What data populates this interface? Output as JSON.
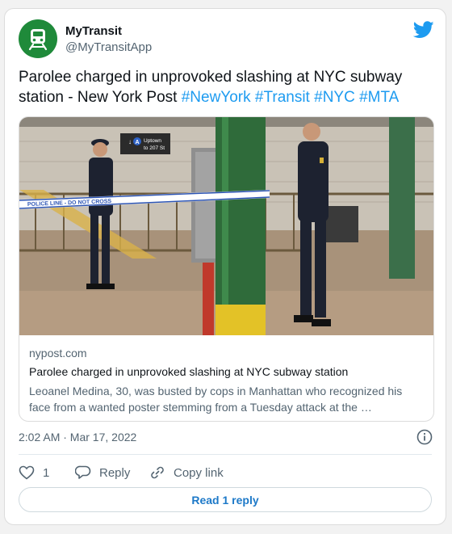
{
  "account": {
    "name": "MyTransit",
    "handle": "@MyTransitApp"
  },
  "tweet": {
    "text": "Parolee charged in unprovoked slashing at NYC subway station - New York Post",
    "hashtags": [
      "#NewYork",
      "#Transit",
      "#NYC",
      "#MTA"
    ]
  },
  "link_card": {
    "domain": "nypost.com",
    "title": "Parolee charged in unprovoked slashing at NYC subway station",
    "description": "Leoanel Medina, 30, was busted by cops in Manhattan who recognized his face from a wanted poster stemming from a Tuesday attack at the …",
    "photo": {
      "sign_line1": "Uptown",
      "sign_line2": "to 207 St",
      "sign_badge": "A",
      "tape_text": "POLICE LINE - DO NOT CROSS"
    }
  },
  "meta": {
    "timestamp": "2:02 AM · Mar 17, 2022"
  },
  "actions": {
    "like_count": "1",
    "reply_label": "Reply",
    "copy_label": "Copy link",
    "read_replies_label": "Read 1 reply"
  },
  "colors": {
    "brand_green": "#1f8a3a",
    "link_blue": "#1d9bf0",
    "twitter_blue": "#1d9bf0",
    "read_reply_blue": "#1d79c8"
  },
  "icons": [
    "train-icon",
    "twitter-bird-icon",
    "info-icon",
    "heart-icon",
    "reply-icon",
    "link-icon"
  ]
}
